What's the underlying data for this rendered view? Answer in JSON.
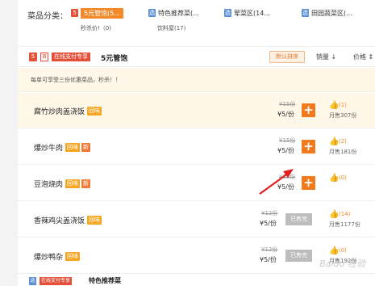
{
  "category_bar": {
    "label": "菜品分类：",
    "items": [
      {
        "badge": "5",
        "badge_color": "#e4513a",
        "label": "5元管饱(5...",
        "sub": "秒杀价!（0)",
        "active": true
      },
      {
        "badge": "选",
        "badge_color": "#5a8ed6",
        "label": "特色推荐菜(...",
        "sub": "饮料屋(17)",
        "active": false
      },
      {
        "badge": "选",
        "badge_color": "#5a8ed6",
        "label": "荤菜区(14...",
        "sub": "",
        "active": false
      },
      {
        "badge": "选",
        "badge_color": "#5a8ed6",
        "label": "田园蔬菜区(...",
        "sub": "",
        "active": false
      }
    ]
  },
  "section": {
    "badge": "5",
    "tag1": "首",
    "tag2": "在线支付专享",
    "title": "5元管饱",
    "sort_default": "默认排序",
    "sort_sales": "销量",
    "sort_price": "价格"
  },
  "notice": "每单可享受三份优惠菜品，秒杀！！",
  "dishes": [
    {
      "name": "腐竹炒肉盖浇饭",
      "hui": "回味",
      "xin": "",
      "old_price": "¥15份",
      "price": "¥5/份",
      "sold_out": false,
      "likes": "(1)",
      "monthly": "月售307份",
      "highlight": true
    },
    {
      "name": "爆炒牛肉",
      "hui": "回味",
      "xin": "新",
      "old_price": "¥15份",
      "price": "¥5/份",
      "sold_out": false,
      "likes": "(2)",
      "monthly": "月售181份",
      "highlight": false
    },
    {
      "name": "豆泡烧肉",
      "hui": "回味",
      "xin": "新",
      "old_price": "¥15份",
      "price": "¥5/份",
      "sold_out": false,
      "likes": "(0)",
      "monthly": "",
      "highlight": false
    },
    {
      "name": "香辣鸡尖盖浇饭",
      "hui": "回味",
      "xin": "",
      "old_price": "¥12份",
      "price": "¥5/份",
      "sold_out": true,
      "sold_label": "已售完",
      "likes": "(14)",
      "monthly": "月售1177份",
      "highlight": false
    },
    {
      "name": "爆炒鸭杂",
      "hui": "回味",
      "xin": "",
      "old_price": "¥12份",
      "price": "¥5/份",
      "sold_out": true,
      "sold_label": "已售完",
      "likes": "(0)",
      "monthly": "月售192份",
      "highlight": false
    }
  ],
  "next_section": {
    "badge": "选",
    "tag": "在线支付专享",
    "title": "特色推荐菜"
  },
  "watermark": "Baidu 经验",
  "colors": {
    "accent": "#f07a1c",
    "red": "#e4513a",
    "blue": "#5a8ed6",
    "highlight_bg": "#fff8e8",
    "arrow": "#e02020"
  }
}
